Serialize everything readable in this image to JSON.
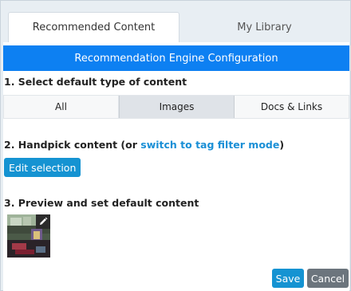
{
  "tabs": [
    {
      "label": "Recommended Content",
      "active": true
    },
    {
      "label": "My Library",
      "active": false
    }
  ],
  "header": {
    "title": "Recommendation Engine Configuration"
  },
  "step1": {
    "title": "1. Select default type of content",
    "options": [
      "All",
      "Images",
      "Docs & Links"
    ],
    "selected": "Images"
  },
  "step2": {
    "title_prefix": "2. Handpick content (or ",
    "link": "switch to tag filter mode",
    "title_suffix": ")",
    "button": "Edit selection"
  },
  "step3": {
    "title": "3. Preview and set default content",
    "thumbnail_icon": "pencil-icon"
  },
  "actions": {
    "save": "Save",
    "cancel": "Cancel"
  },
  "colors": {
    "header_bg": "#0d80f2",
    "primary_button": "#1593d2",
    "cancel_button": "#6c757d",
    "link": "#1a8fd6"
  }
}
